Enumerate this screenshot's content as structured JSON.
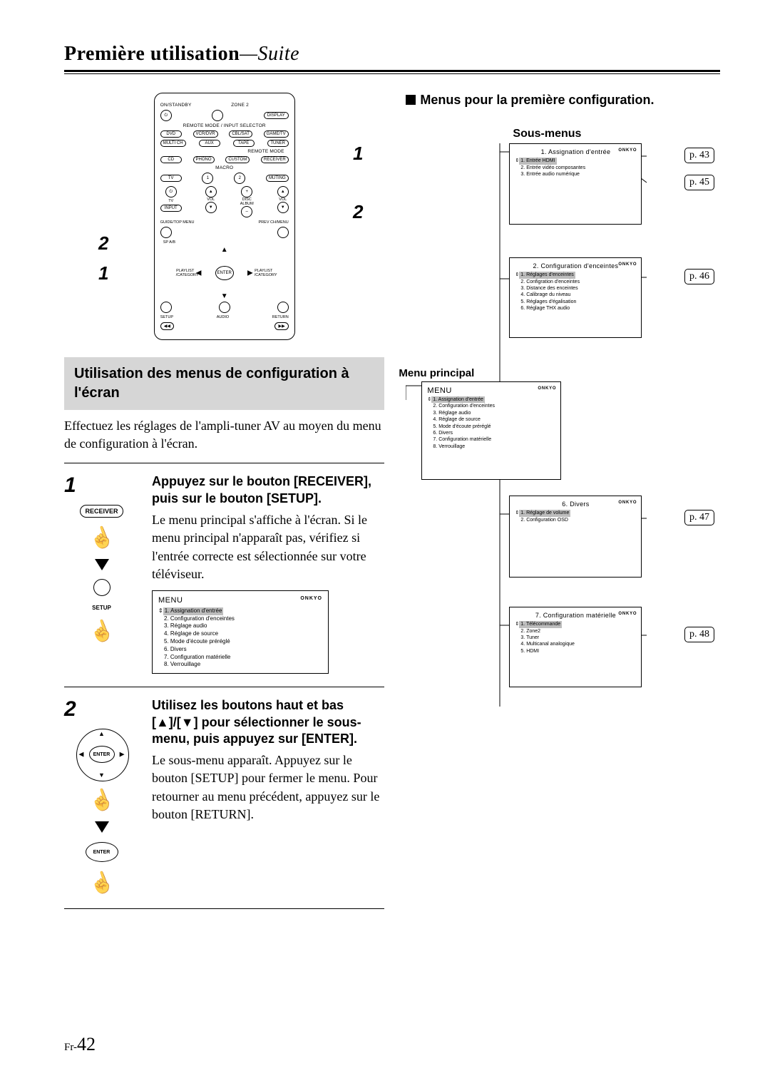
{
  "page_header": {
    "main": "Première utilisation",
    "suffix": "—Suite"
  },
  "page_number": {
    "prefix": "Fr-",
    "number": "42"
  },
  "remote_callouts": {
    "n1": "1",
    "n2": "2"
  },
  "remote": {
    "row_top_labels": {
      "l": "ON/STANDBY",
      "r": "ZONE 2",
      "display": "DISPLAY"
    },
    "selector_label": "REMOTE MODE / INPUT SELECTOR",
    "selector_row": [
      "DVD",
      "VCR/DVR",
      "CBL/SAT",
      "GAME/TV"
    ],
    "row2": [
      "MULTI CH",
      "AUX",
      "TAPE",
      "TUNER"
    ],
    "remote_mode_label": "REMOTE MODE",
    "row3": [
      "CD",
      "PHONO",
      "CUSTOM",
      "RECEIVER"
    ],
    "macro_label": "MACRO",
    "row4": {
      "tv": "TV",
      "m1": "1",
      "m2": "2",
      "muting": "MUTING"
    },
    "row5": {
      "onstandby": "⏻",
      "tv": "TV",
      "vol": "VOL",
      "disc": "DISC",
      "album": "ALBUM",
      "input": "INPUT"
    },
    "row6": {
      "guide": "GUIDE/TOP MENU",
      "prev": "PREV CH/MENU",
      "spab": "SP A/B"
    },
    "dpad": {
      "enter": "ENTER",
      "playlist": "PLAYLIST\n/CATEGORY"
    },
    "row7": {
      "setup": "SETUP",
      "audio": "AUDIO",
      "return": "RETURN"
    }
  },
  "section_title": "Utilisation des menus de configuration à l'écran",
  "section_body": "Effectuez les réglages de l'ampli-tuner AV au moyen du menu de configuration à l'écran.",
  "steps": {
    "s1": {
      "num": "1",
      "heading": "Appuyez sur le bouton [RECEIVER], puis sur le bouton [SETUP].",
      "body": "Le menu principal s'affiche à l'écran. Si le menu principal n'apparaît pas, vérifiez si l'entrée correcte est sélectionnée sur votre téléviseur.",
      "receiver_btn": "RECEIVER",
      "setup_label": "SETUP",
      "menu": {
        "title": "MENU",
        "brand": "ONKYO",
        "items": [
          "1. Assignation d'entrée",
          "2. Configuration d'enceintes",
          "3. Réglage audio",
          "4. Réglage de source",
          "5. Mode d'écoute préréglé",
          "6. Divers",
          "7. Configuration matérielle",
          "8. Verrouillage"
        ],
        "selected_index": 0
      }
    },
    "s2": {
      "num": "2",
      "heading": "Utilisez les boutons haut et bas [▲]/[▼] pour sélectionner le sous-menu, puis appuyez sur [ENTER].",
      "body": "Le sous-menu apparaît. Appuyez sur le bouton [SETUP] pour fermer le menu. Pour retourner au menu précédent, appuyez sur le bouton [RETURN].",
      "enter_label": "ENTER"
    }
  },
  "right": {
    "heading": "Menus pour la première configuration.",
    "submenus_label": "Sous-menus",
    "main_menu_label": "Menu principal",
    "refs": {
      "p43": "p. 43",
      "p45": "p. 45",
      "p46": "p. 46",
      "p47": "p. 47",
      "p48": "p. 48"
    },
    "main_menu": {
      "title": "MENU",
      "brand": "ONKYO",
      "items": [
        "1. Assignation d'entrée",
        "2. Configuration d'enceintes",
        "3. Réglage audio",
        "4. Réglage de source",
        "5. Mode d'écoute préréglé",
        "6. Divers",
        "7. Configuration matérielle",
        "8. Verrouillage"
      ],
      "selected_index": 0
    },
    "sub1": {
      "title": "1.   Assignation d'entrée",
      "brand": "ONKYO",
      "items": [
        "1.   Entrée HDMI",
        "2.   Entrée vidéo composantes",
        "3.   Entrée audio numérique"
      ],
      "selected_index": 0
    },
    "sub2": {
      "title": "2.   Configuration d'enceintes",
      "brand": "ONKYO",
      "items": [
        "1.   Réglages d'enceintes",
        "2.   Configration d'enceintes",
        "3.   Distance des enceintes",
        "4.   Calibrage du niveau",
        "5.   Réglages d'égalisation",
        "6.   Réglage THX audio"
      ],
      "selected_index": 0
    },
    "sub6": {
      "title": "6.   Divers",
      "brand": "ONKYO",
      "items": [
        "1.   Réglage de volume",
        "2.   Configuration OSD"
      ],
      "selected_index": 0
    },
    "sub7": {
      "title": "7.   Configuration matérielle",
      "brand": "ONKYO",
      "items": [
        "1.   Télécommande",
        "2.   Zone2",
        "3.   Tuner",
        "4.   Multicanal analogique",
        "5.   HDMI"
      ],
      "selected_index": 0
    }
  }
}
